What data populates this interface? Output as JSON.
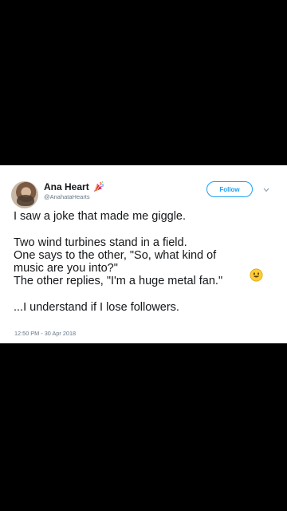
{
  "tweet": {
    "author": {
      "display_name": "Ana Heart",
      "handle": "@AnahataHearts",
      "badge_icon": "party-popper-icon",
      "avatar_icon": "avatar"
    },
    "follow_label": "Follow",
    "menu_icon": "chevron-down-icon",
    "text_lines": [
      "I saw a joke that made me giggle.",
      "Two wind turbines stand in a field.",
      "One says to the other, \"So, what kind of",
      "music are you into?\"",
      "The other replies, \"I'm a huge metal fan.\"",
      "...I understand if I lose followers."
    ],
    "emoji_icon": "smiling-face-icon",
    "timestamp": "12:50 PM - 30 Apr 2018"
  },
  "colors": {
    "background": "#000000",
    "card": "#ffffff",
    "accent": "#1da1f2",
    "text": "#14171a",
    "secondary_text": "#657786"
  }
}
